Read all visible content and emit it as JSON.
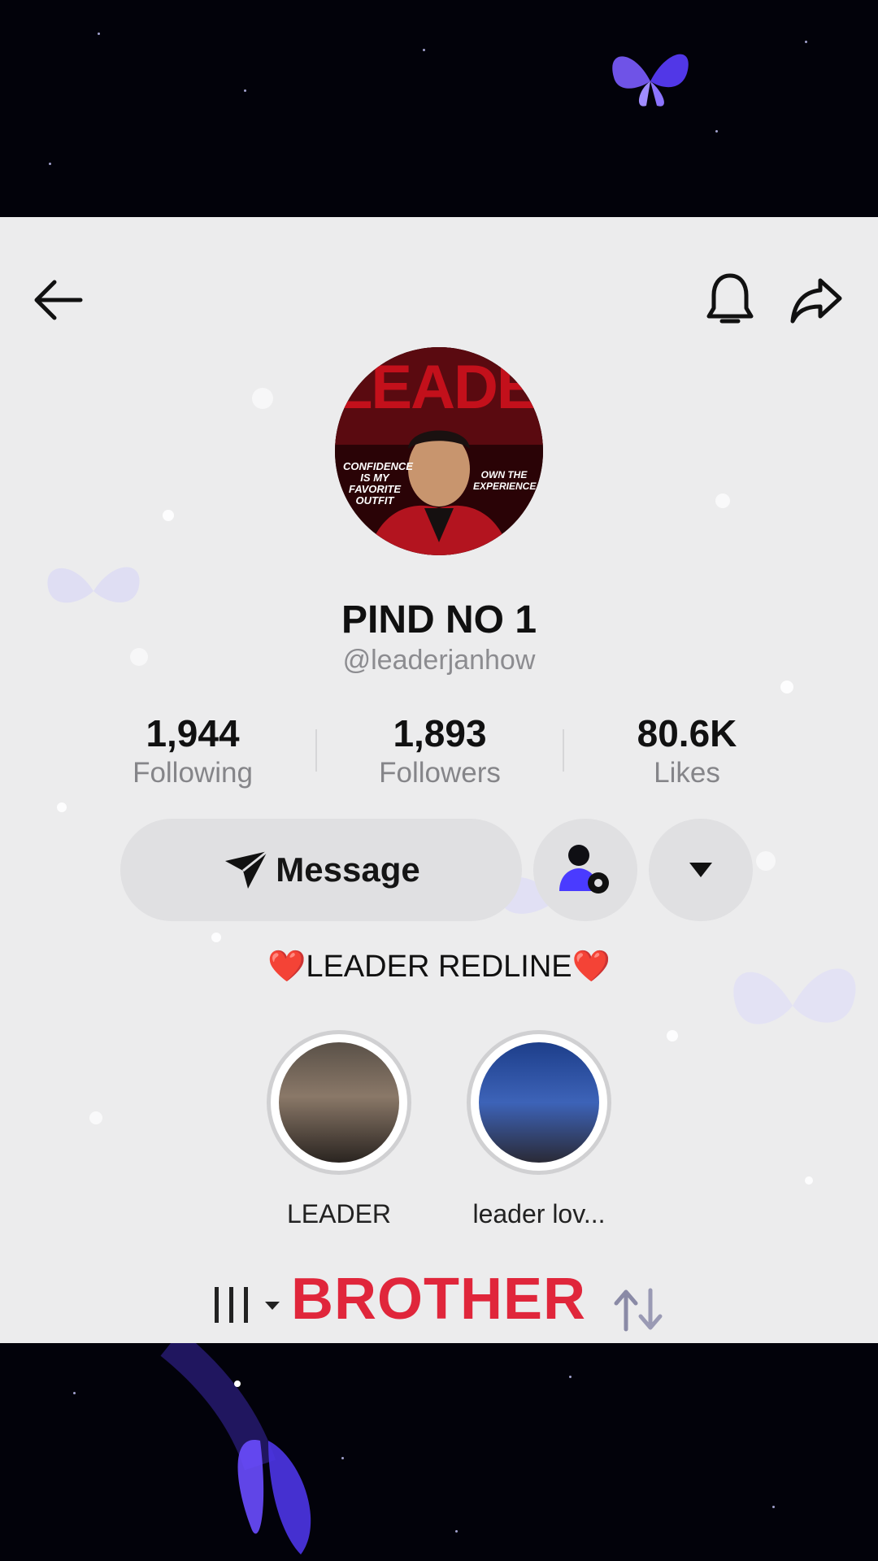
{
  "profile": {
    "display_name": "PIND NO 1",
    "username": "@leaderjanhow",
    "bio": "❤️LEADER REDLINE❤️",
    "avatar": {
      "headline": "LEADER",
      "left_text": "CONFIDENCE IS MY FAVORITE OUTFIT",
      "right_text": "OWN THE EXPERIENCE"
    }
  },
  "stats": [
    {
      "value": "1,944",
      "label": "Following"
    },
    {
      "value": "1,893",
      "label": "Followers"
    },
    {
      "value": "80.6K",
      "label": "Likes"
    }
  ],
  "actions": {
    "message_label": "Message"
  },
  "highlights": [
    {
      "label": "LEADER"
    },
    {
      "label": "leader lov..."
    }
  ],
  "overlay": {
    "text": "BROTHER"
  },
  "colors": {
    "overlay_text": "#e0263b",
    "panel_bg": "#ececed",
    "band_bg": "#02020a",
    "accent_purple": "#5a3dff"
  },
  "icons": [
    "back-arrow-icon",
    "bell-icon",
    "share-icon",
    "send-icon",
    "add-friend-icon",
    "dropdown-arrow-icon",
    "bars-icon",
    "sort-icon"
  ]
}
